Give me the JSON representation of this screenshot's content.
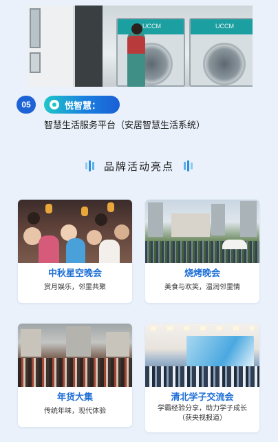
{
  "top_photo": {
    "brand_text": "UCCM"
  },
  "feature": {
    "number": "05",
    "label": "悦智慧：",
    "description": "智慧生活服务平台（安居智慧生活系统）"
  },
  "section": {
    "heading": "品牌活动亮点"
  },
  "cards": [
    {
      "title": "中秋星空晚会",
      "subtitle": "赏月娱乐，邻里共聚"
    },
    {
      "title": "烧烤晚会",
      "subtitle": "美食与欢笑，温润邻里情"
    },
    {
      "title": "年货大集",
      "subtitle": "传统年味，现代体验"
    },
    {
      "title": "清北学子交流会",
      "subtitle": "学霸经验分享，助力学子成长",
      "subtitle2": "（获央视报道）"
    }
  ],
  "colors": {
    "background": "#eaf1fb",
    "accent_blue": "#1e63d6",
    "title_blue": "#1e6fd6",
    "teal": "#1ec6c8"
  }
}
